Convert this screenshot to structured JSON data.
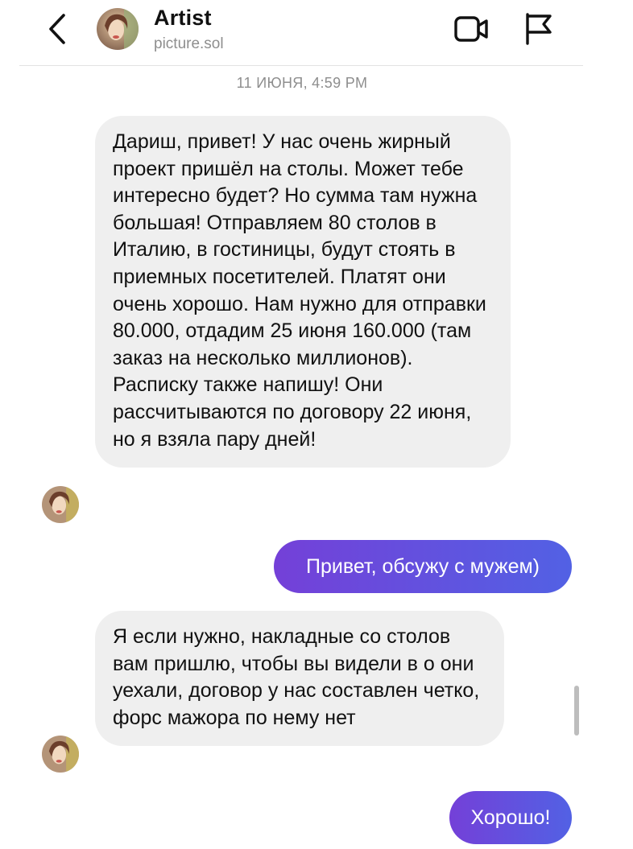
{
  "header": {
    "back_icon": "chevron-left-icon",
    "name": "Artist",
    "username": "picture.sol",
    "video_icon": "video-call-icon",
    "flag_icon": "flag-icon"
  },
  "thread": {
    "timestamp": "11 ИЮНЯ, 4:59 PM",
    "messages": [
      {
        "from": "contact",
        "text": "Дариш, привет! У нас очень жирный проект пришёл на столы. Может тебе интересно будет? Но сумма там нужна большая! Отправляем 80 столов в Италию, в гостиницы, будут стоять в приемных посетителей. Платят они очень хорошо. Нам нужно для отправки 80.000, отдадим 25 июня 160.000 (там заказ на несколько миллионов). Расписку также напишу! Они рассчитываются по договору 22 июня, но я взяла пару дней!"
      },
      {
        "from": "me",
        "text": "Привет, обсужу с мужем)"
      },
      {
        "from": "contact",
        "text": "Я если нужно, накладные со столов вам пришлю, чтобы вы видели в о они уехали, договор у нас составлен четко, форс мажора по нему нет"
      },
      {
        "from": "me",
        "text": "Хорошо!"
      }
    ]
  },
  "colors": {
    "incoming_bubble": "#efefef",
    "outgoing_gradient_start": "#7440d8",
    "outgoing_gradient_end": "#5261e4",
    "muted_text": "#8e8e8e"
  }
}
